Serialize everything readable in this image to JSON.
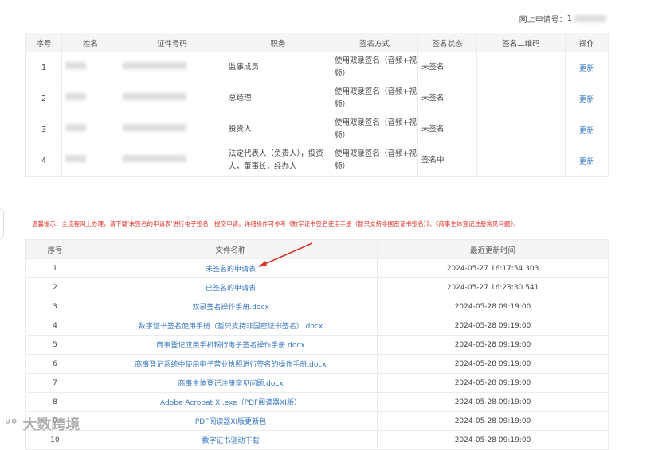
{
  "header": {
    "app_no_label": "网上申请号：",
    "app_no_visible": "1"
  },
  "signers": {
    "columns": [
      "序号",
      "姓名",
      "证件号码",
      "职务",
      "签名方式",
      "签名状态",
      "签名二维码",
      "操作"
    ],
    "rows": [
      {
        "no": "1",
        "role": "监事成员",
        "method": "使用双录签名（音频+视频）",
        "status": "未签名",
        "action": "更新"
      },
      {
        "no": "2",
        "role": "总经理",
        "method": "使用双录签名（音频+视频）",
        "status": "未签名",
        "action": "更新"
      },
      {
        "no": "3",
        "role": "投资人",
        "method": "使用双录签名（音频+视频）",
        "status": "未签名",
        "action": "更新"
      },
      {
        "no": "4",
        "role": "法定代表人（负责人），投资人，董事长，经办人",
        "method": "使用双录签名（音频+视频）",
        "status": "签名中",
        "action": "更新"
      }
    ]
  },
  "notice": "温馨提示：全流程网上办理，请下载'未签名的申请表'进行电子签名，提交申请。详细操作可参考《数字证书签名使用手册（暂只支持非国密证书签名）》、《商事主体登记注册常见问题》。",
  "files": {
    "columns": [
      "序号",
      "文件名称",
      "最近更新时间"
    ],
    "rows": [
      {
        "no": "1",
        "name": "未签名的申请表",
        "time": "2024-05-27 16:17:54.303"
      },
      {
        "no": "2",
        "name": "已签名的申请表",
        "time": "2024-05-27 16:23:30.541"
      },
      {
        "no": "3",
        "name": "双录签名操作手册.docx",
        "time": "2024-05-28 09:19:00"
      },
      {
        "no": "4",
        "name": "数字证书签名使用手册（暂只支持非国密证书签名）.docx",
        "time": "2024-05-28 09:19:00"
      },
      {
        "no": "5",
        "name": "商事登记应用手机银行电子签名操作手册.docx",
        "time": "2024-05-28 09:19:00"
      },
      {
        "no": "6",
        "name": "商事登记系统中使用电子营业执照进行签名的操作手册.docx",
        "time": "2024-05-28 09:19:00"
      },
      {
        "no": "7",
        "name": "商事主体登记注册常见问题.docx",
        "time": "2024-05-28 09:19:00"
      },
      {
        "no": "8",
        "name": "Adobe Acrobat XI.exe（PDF阅读器XI版）",
        "time": "2024-05-28 09:19:00"
      },
      {
        "no": "9",
        "name": "PDF阅读器XI版更新包",
        "time": "2024-05-28 09:19:00"
      },
      {
        "no": "10",
        "name": "数字证书驱动下载",
        "time": "2024-05-28 09:19:00"
      }
    ]
  },
  "watermark": "大数跨境",
  "colors": {
    "link": "#3a78c3",
    "warning": "#e0312a",
    "arrow": "#d9302a"
  }
}
